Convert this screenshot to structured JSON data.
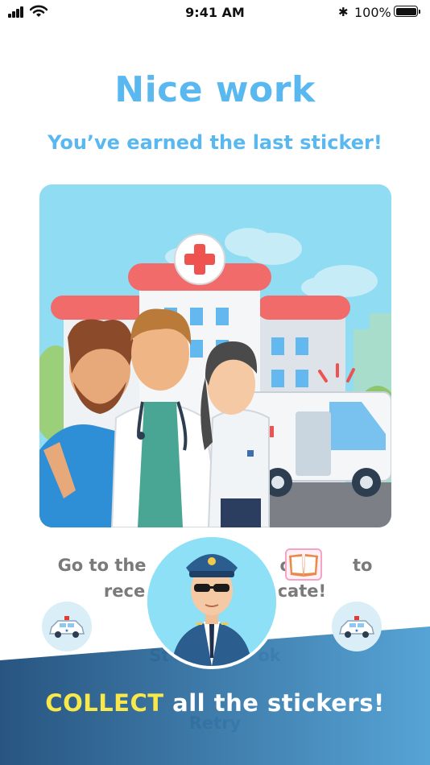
{
  "status_bar": {
    "time": "9:41 AM",
    "battery_percent": "100%",
    "battery_level": 1.0,
    "icons": [
      "signal-icon",
      "wifi-icon",
      "bluetooth-icon",
      "battery-icon"
    ]
  },
  "header": {
    "title": "Nice work",
    "subtitle": "You’ve earned the last sticker!"
  },
  "sticker": {
    "illustration": "hospital-workers-sticker",
    "icons": [
      "hospital-building",
      "ambulance",
      "doctor",
      "nurse",
      "patient"
    ]
  },
  "instructions": {
    "line1_a": "Go to the",
    "line1_b": "ok",
    "line1_c": "to",
    "line2_a": "recei",
    "line2_b": "icate!",
    "book_icon": "sticker-book-icon"
  },
  "buttons": {
    "sticker_book_partial_left": "St",
    "sticker_book_partial_right": "ok",
    "retry_label": "Retry"
  },
  "banner": {
    "highlight": "COLLECT",
    "rest": " all the stickers!"
  },
  "badges": {
    "left_icon": "police-car-icon",
    "right_icon": "police-car-icon",
    "center_icon": "police-officer-avatar"
  },
  "colors": {
    "accent": "#5ab8f0",
    "banner_dark": "#1c4f7c",
    "banner_light": "#4fa3d8",
    "highlight": "#f9e84a",
    "hospital_red": "#f26b6b"
  }
}
